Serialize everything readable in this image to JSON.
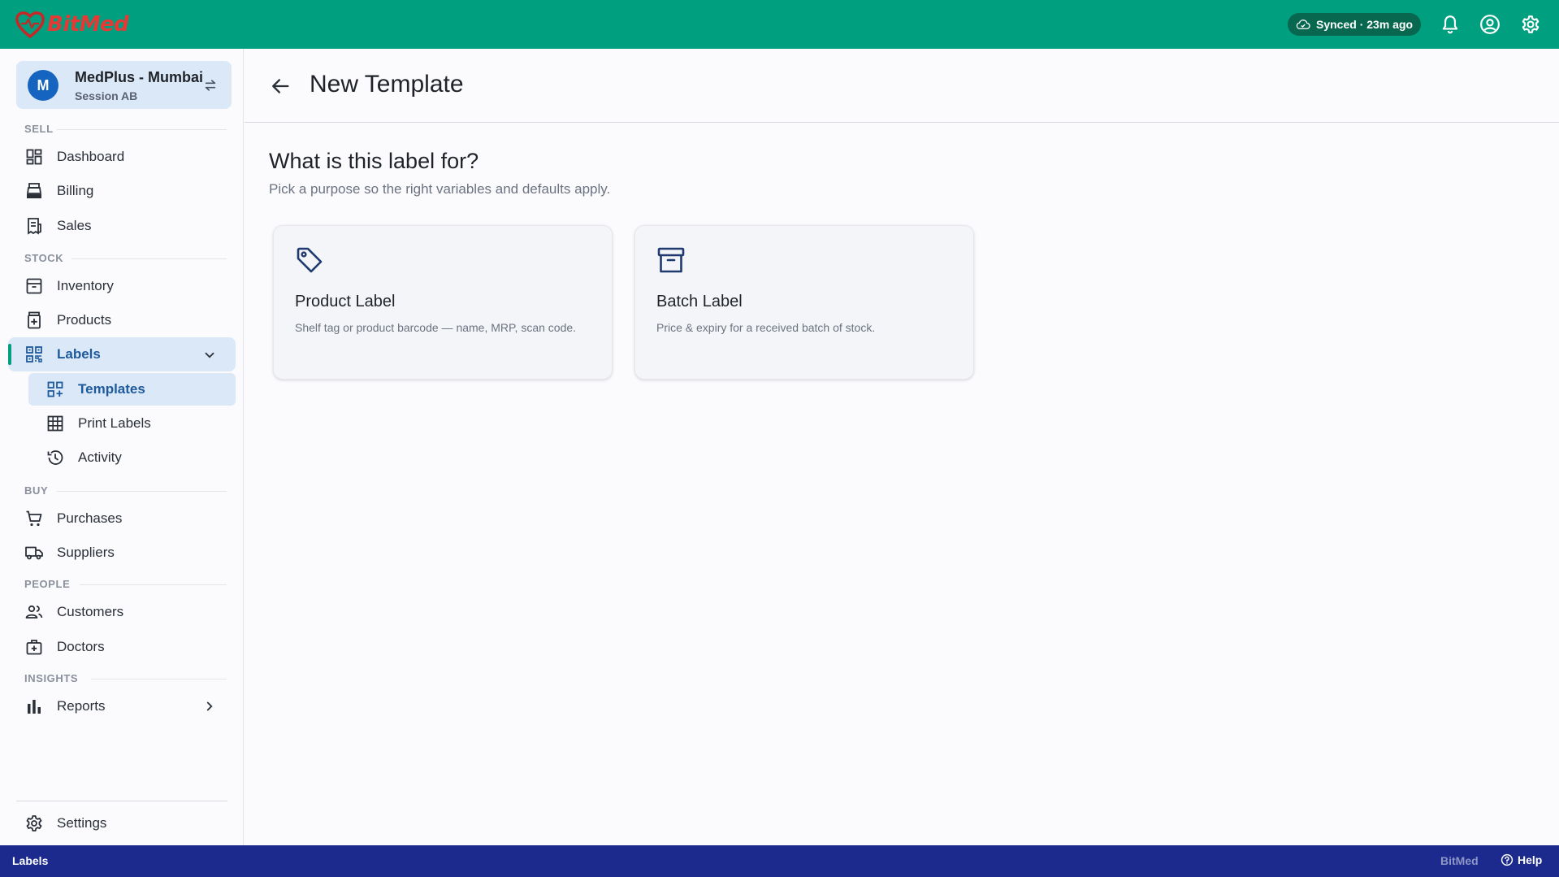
{
  "app": {
    "name": "BitMed",
    "brand_color": "#009f7f",
    "logo_color": "#e53935"
  },
  "topbar": {
    "sync_status": "Synced · 23m ago",
    "icons": [
      "cloud-check-icon",
      "bell-icon",
      "account-circle-icon",
      "gear-icon"
    ]
  },
  "store": {
    "avatar": "M",
    "name": "MedPlus - Mumbai",
    "session": "Session AB"
  },
  "sidebar": {
    "sections": {
      "sell": "SELL",
      "stock": "STOCK",
      "buy": "BUY",
      "people": "PEOPLE",
      "insights": "INSIGHTS"
    },
    "items": {
      "dashboard": "Dashboard",
      "billing": "Billing",
      "sales": "Sales",
      "inventory": "Inventory",
      "products": "Products",
      "labels": "Labels",
      "templates": "Templates",
      "print_labels": "Print Labels",
      "activity": "Activity",
      "purchases": "Purchases",
      "suppliers": "Suppliers",
      "customers": "Customers",
      "doctors": "Doctors",
      "reports": "Reports",
      "settings": "Settings"
    },
    "active_item": "Labels",
    "active_subitem": "Templates"
  },
  "main": {
    "title": "New Template",
    "question": "What is this label for?",
    "subtext": "Pick a purpose so the right variables and defaults apply.",
    "cards": [
      {
        "title": "Product Label",
        "description": "Shelf tag or product barcode — name, MRP, scan code.",
        "icon": "tag-icon"
      },
      {
        "title": "Batch Label",
        "description": "Price & expiry for a received batch of stock.",
        "icon": "archive-box-icon"
      }
    ]
  },
  "statusbar": {
    "section": "Labels",
    "brand": "BitMed",
    "help": "Help",
    "color": "#1b2a8c"
  }
}
